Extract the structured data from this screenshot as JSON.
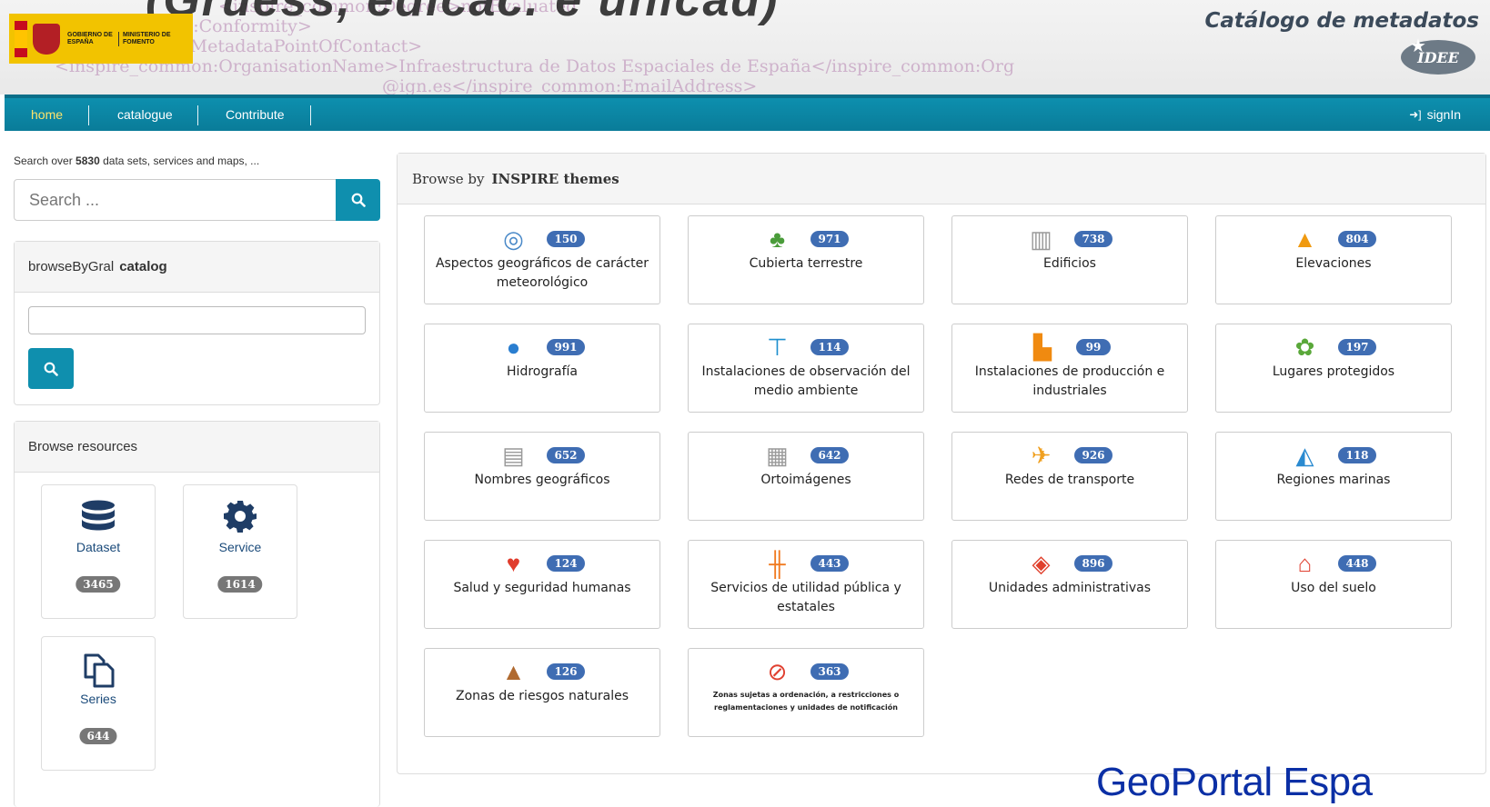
{
  "header": {
    "xml_lines": [
      "<inspire_common:Degree>notEvaluated",
      "n:Conformity>",
      "n:MetadataPointOfContact>",
      "<inspire_common:OrganisationName>Infraestructura de Datos Espaciales de España</inspire_common:Org",
      "@ign.es</inspire_common:EmailAddress>"
    ],
    "logo_left_text": "GOBIERNO DE ESPAÑA",
    "logo_right_text": "MINISTERIO DE FOMENTO",
    "site_title": "Catálogo de metadatos",
    "idee_text": "IDEE",
    "ghost_title": "(Gruess, edicac. e unicad)"
  },
  "nav": {
    "items": [
      {
        "label": "home",
        "active": true
      },
      {
        "label": "catalogue",
        "active": false
      },
      {
        "label": "Contribute",
        "active": false
      }
    ],
    "signin_label": "signIn"
  },
  "search": {
    "hint_prefix": "Search over",
    "hint_count": "5830",
    "hint_suffix": "data sets, services and maps, ...",
    "placeholder": "Search ..."
  },
  "browse_gral": {
    "label": "browseByGral",
    "label_bold": "catalog"
  },
  "browse_resources": {
    "title": "Browse resources",
    "items": [
      {
        "label": "Dataset",
        "count": "3465",
        "icon": "database-icon"
      },
      {
        "label": "Service",
        "count": "1614",
        "icon": "gear-icon"
      },
      {
        "label": "Series",
        "count": "644",
        "icon": "copy-icon"
      }
    ]
  },
  "themes": {
    "heading_prefix": "Browse by",
    "heading_bold": "INSPIRE themes",
    "items": [
      {
        "label": "Aspectos geográficos de carácter meteorológico",
        "count": "150",
        "icon": "weather-icon",
        "color": "#4a89c8"
      },
      {
        "label": "Cubierta terrestre",
        "count": "971",
        "icon": "land-cover-icon",
        "color": "#4a9c3a"
      },
      {
        "label": "Edificios",
        "count": "738",
        "icon": "buildings-icon",
        "color": "#9a9a9a"
      },
      {
        "label": "Elevaciones",
        "count": "804",
        "icon": "elevation-icon",
        "color": "#f09a10"
      },
      {
        "label": "Hidrografía",
        "count": "991",
        "icon": "water-drop-icon",
        "color": "#2a7ed0"
      },
      {
        "label": "Instalaciones de observación del medio ambiente",
        "count": "114",
        "icon": "observation-icon",
        "color": "#1e8fce"
      },
      {
        "label": "Instalaciones de producción e industriales",
        "count": "99",
        "icon": "factory-icon",
        "color": "#f08a10"
      },
      {
        "label": "Lugares protegidos",
        "count": "197",
        "icon": "protected-sites-icon",
        "color": "#5aa83a"
      },
      {
        "label": "Nombres geográficos",
        "count": "652",
        "icon": "geo-names-icon",
        "color": "#999999"
      },
      {
        "label": "Ortoimágenes",
        "count": "642",
        "icon": "orthoimage-icon",
        "color": "#9a9a9a"
      },
      {
        "label": "Redes de transporte",
        "count": "926",
        "icon": "transport-icon",
        "color": "#f0a020"
      },
      {
        "label": "Regiones marinas",
        "count": "118",
        "icon": "sea-regions-icon",
        "color": "#2a8ad0"
      },
      {
        "label": "Salud y seguridad humanas",
        "count": "124",
        "icon": "health-icon",
        "color": "#e03c2c"
      },
      {
        "label": "Servicios de utilidad pública y estatales",
        "count": "443",
        "icon": "utility-icon",
        "color": "#f07a20"
      },
      {
        "label": "Unidades administrativas",
        "count": "896",
        "icon": "admin-units-icon",
        "color": "#e0402c"
      },
      {
        "label": "Uso del suelo",
        "count": "448",
        "icon": "land-use-icon",
        "color": "#e04030"
      },
      {
        "label": "Zonas de riesgos naturales",
        "count": "126",
        "icon": "natural-risk-icon",
        "color": "#b06a30"
      },
      {
        "label": "Zonas sujetas a ordenación, a restricciones o reglamentaciones y unidades de notificación",
        "count": "363",
        "icon": "restricted-zones-icon",
        "color": "#e04030"
      }
    ]
  },
  "brand_footer": "GeoPortal Espa"
}
